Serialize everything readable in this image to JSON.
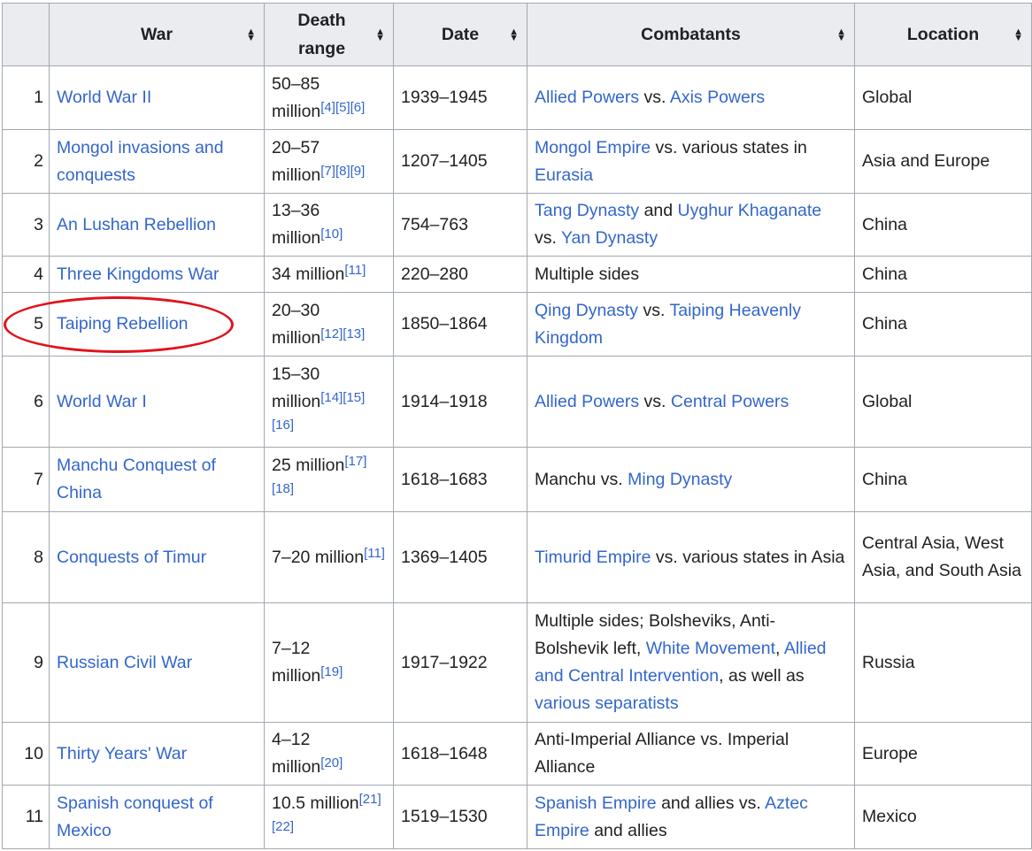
{
  "headers": {
    "rank": "",
    "war": "War",
    "death_range_1": "Death",
    "death_range_2": "range",
    "date": "Date",
    "combatants": "Combatants",
    "location": "Location"
  },
  "sort_icon": "sort-arrows",
  "annotation": {
    "highlighted_row": 5,
    "color": "#e0141b",
    "shape": "ellipse"
  },
  "rows": [
    {
      "rank": "1",
      "war": "World War II",
      "death_range": "50–85 million",
      "death_refs": [
        "[4]",
        "[5]",
        "[6]"
      ],
      "date": "1939–1945",
      "combatants": [
        {
          "text": "Allied Powers",
          "link": true
        },
        {
          "text": " vs. ",
          "link": false
        },
        {
          "text": "Axis Powers",
          "link": true
        }
      ],
      "location": "Global"
    },
    {
      "rank": "2",
      "war": "Mongol invasions and conquests",
      "death_range": "20–57 million",
      "death_refs": [
        "[7]",
        "[8]",
        "[9]"
      ],
      "date": "1207–1405",
      "combatants": [
        {
          "text": "Mongol Empire",
          "link": true
        },
        {
          "text": " vs. various states in ",
          "link": false
        },
        {
          "text": "Eurasia",
          "link": true
        }
      ],
      "location": "Asia and Europe"
    },
    {
      "rank": "3",
      "war": "An Lushan Rebellion",
      "death_range": "13–36 million",
      "death_refs": [
        "[10]"
      ],
      "date": "754–763",
      "combatants": [
        {
          "text": "Tang Dynasty",
          "link": true
        },
        {
          "text": " and ",
          "link": false
        },
        {
          "text": "Uyghur Khaganate",
          "link": true
        },
        {
          "text": " vs. ",
          "link": false
        },
        {
          "text": "Yan Dynasty",
          "link": true
        }
      ],
      "location": "China"
    },
    {
      "rank": "4",
      "war": "Three Kingdoms War",
      "death_range": "34 million",
      "death_refs": [
        "[11]"
      ],
      "date": "220–280",
      "combatants": [
        {
          "text": "Multiple sides",
          "link": false
        }
      ],
      "location": "China"
    },
    {
      "rank": "5",
      "war": "Taiping Rebellion",
      "death_range": "20–30 million",
      "death_refs": [
        "[12]",
        "[13]"
      ],
      "date": "1850–1864",
      "combatants": [
        {
          "text": "Qing Dynasty",
          "link": true
        },
        {
          "text": " vs. ",
          "link": false
        },
        {
          "text": "Taiping Heavenly Kingdom",
          "link": true
        }
      ],
      "location": "China"
    },
    {
      "rank": "6",
      "war": "World War I",
      "death_range": "15–30 million",
      "death_refs": [
        "[14]",
        "[15]",
        "[16]"
      ],
      "date": "1914–1918",
      "combatants": [
        {
          "text": "Allied Powers",
          "link": true
        },
        {
          "text": " vs. ",
          "link": false
        },
        {
          "text": "Central Powers",
          "link": true
        }
      ],
      "location": "Global"
    },
    {
      "rank": "7",
      "war": "Manchu Conquest of China",
      "death_range": "25 million",
      "death_refs": [
        "[17]",
        "[18]"
      ],
      "date": "1618–1683",
      "combatants": [
        {
          "text": "Manchu vs. ",
          "link": false
        },
        {
          "text": "Ming Dynasty",
          "link": true
        }
      ],
      "location": "China"
    },
    {
      "rank": "8",
      "war": "Conquests of Timur",
      "death_range": "7–20 million",
      "death_refs": [
        "[11]"
      ],
      "date": "1369–1405",
      "combatants": [
        {
          "text": "Timurid Empire",
          "link": true
        },
        {
          "text": " vs. various states in Asia",
          "link": false
        }
      ],
      "location": "Central Asia, West Asia, and South Asia"
    },
    {
      "rank": "9",
      "war": "Russian Civil War",
      "death_range": "7–12 million",
      "death_refs": [
        "[19]"
      ],
      "date": "1917–1922",
      "combatants": [
        {
          "text": "Multiple sides; Bolsheviks, Anti-Bolshevik left, ",
          "link": false
        },
        {
          "text": "White Movement",
          "link": true
        },
        {
          "text": ", ",
          "link": false
        },
        {
          "text": "Allied and Central Intervention",
          "link": true
        },
        {
          "text": ", as well as ",
          "link": false
        },
        {
          "text": "various separatists",
          "link": true
        }
      ],
      "location": "Russia"
    },
    {
      "rank": "10",
      "war": "Thirty Years' War",
      "death_range": "4–12 million",
      "death_refs": [
        "[20]"
      ],
      "date": "1618–1648",
      "combatants": [
        {
          "text": "Anti-Imperial Alliance vs. Imperial Alliance",
          "link": false
        }
      ],
      "location": "Europe"
    },
    {
      "rank": "11",
      "war": "Spanish conquest of Mexico",
      "death_range": "10.5 million",
      "death_refs": [
        "[21]",
        "[22]"
      ],
      "date": "1519–1530",
      "combatants": [
        {
          "text": "Spanish Empire",
          "link": true
        },
        {
          "text": " and allies vs. ",
          "link": false
        },
        {
          "text": "Aztec Empire",
          "link": true
        },
        {
          "text": " and allies",
          "link": false
        }
      ],
      "location": "Mexico"
    }
  ]
}
